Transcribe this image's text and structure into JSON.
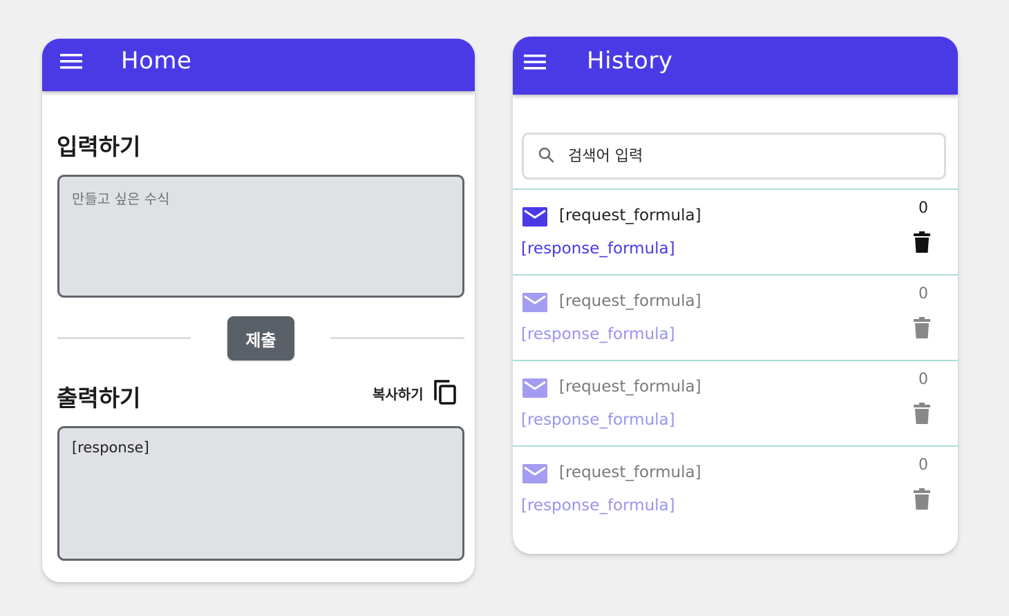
{
  "colors": {
    "appbar": "#4a3ae6",
    "accent": "#4a3ae6",
    "accent_light": "#a49cf0",
    "divider": "#a9ded8",
    "button": "#5a6068"
  },
  "home": {
    "title": "Home",
    "menu_icon": "menu-icon",
    "input_section_title": "입력하기",
    "input_placeholder": "만들고 싶은 수식",
    "submit_label": "제출",
    "output_section_title": "출력하기",
    "copy_label": "복사하기",
    "copy_icon": "copy-icon",
    "response": "[response]"
  },
  "history": {
    "title": "History",
    "menu_icon": "menu-icon",
    "search_icon": "search-icon",
    "search_placeholder": "검색어 입력",
    "items": [
      {
        "request": "[request_formula]",
        "response": "[response_formula]",
        "count": "0",
        "state": "active"
      },
      {
        "request": "[request_formula]",
        "response": "[response_formula]",
        "count": "0",
        "state": "inactive"
      },
      {
        "request": "[request_formula]",
        "response": "[response_formula]",
        "count": "0",
        "state": "inactive"
      },
      {
        "request": "[request_formula]",
        "response": "[response_formula]",
        "count": "0",
        "state": "inactive"
      }
    ]
  }
}
